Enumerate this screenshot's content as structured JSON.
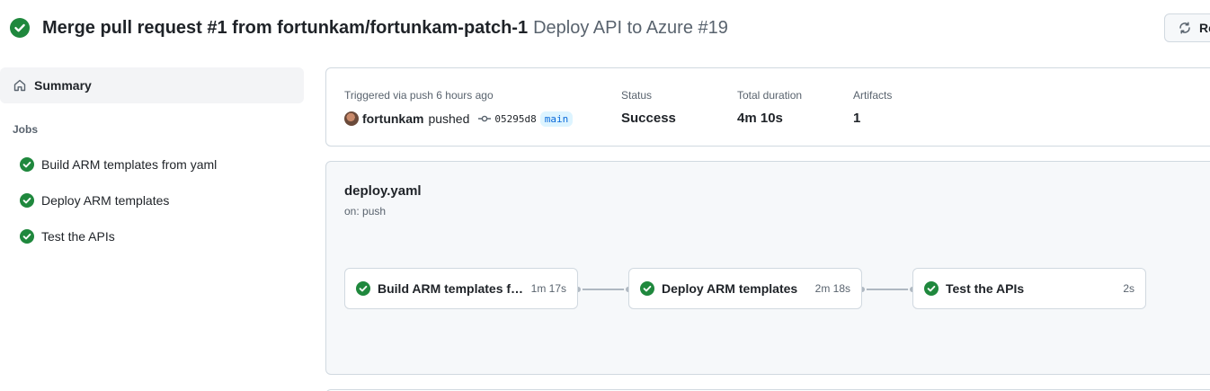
{
  "header": {
    "title": "Merge pull request #1 from fortunkam/fortunkam-patch-1",
    "subtitle": "Deploy API to Azure #19",
    "status_icon": "check-circle-fill-icon",
    "rerun_label": "Re"
  },
  "sidebar": {
    "summary_label": "Summary",
    "summary_icon": "home-icon",
    "jobs_heading": "Jobs",
    "jobs": [
      {
        "label": "Build ARM templates from yaml"
      },
      {
        "label": "Deploy ARM templates"
      },
      {
        "label": "Test the APIs"
      }
    ]
  },
  "run_info": {
    "trigger_label": "Triggered via push 6 hours ago",
    "actor": "fortunkam",
    "action": "pushed",
    "commit_sha": "05295d8",
    "branch": "main",
    "status_label": "Status",
    "status_value": "Success",
    "duration_label": "Total duration",
    "duration_value": "4m 10s",
    "artifacts_label": "Artifacts",
    "artifacts_value": "1"
  },
  "workflow": {
    "file": "deploy.yaml",
    "trigger": "on: push",
    "jobs": [
      {
        "name": "Build ARM templates from yaml",
        "display_name": "Build ARM templates fro...",
        "duration": "1m 17s"
      },
      {
        "name": "Deploy ARM templates",
        "display_name": "Deploy ARM templates",
        "duration": "2m 18s"
      },
      {
        "name": "Test the APIs",
        "display_name": "Test the APIs",
        "duration": "2s"
      }
    ]
  },
  "colors": {
    "success": "#1f883d",
    "muted_text": "#59636e",
    "border": "#d1d9e0",
    "branch_bg": "#ddf4ff",
    "branch_fg": "#0969da"
  }
}
